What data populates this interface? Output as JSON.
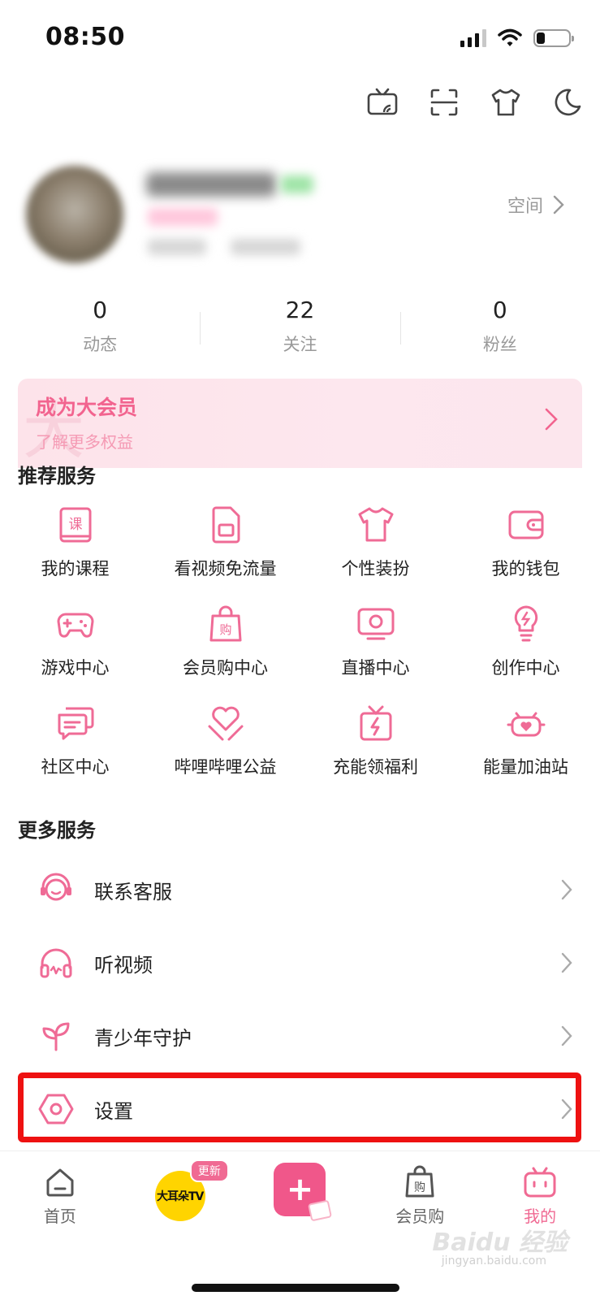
{
  "status_bar": {
    "time": "08:50",
    "battery_level": 0.25
  },
  "top_toolbar": {
    "icons": [
      "cast-tv-icon",
      "scan-icon",
      "dress-up-icon",
      "night-mode-icon"
    ]
  },
  "profile": {
    "space_label": "空间"
  },
  "stats": [
    {
      "value": "0",
      "label": "动态"
    },
    {
      "value": "22",
      "label": "关注"
    },
    {
      "value": "0",
      "label": "粉丝"
    }
  ],
  "vip_banner": {
    "title": "成为大会员",
    "subtitle": "了解更多权益"
  },
  "recommended": {
    "title": "推荐服务",
    "items": [
      {
        "label": "我的课程",
        "icon": "course-book-icon"
      },
      {
        "label": "看视频免流量",
        "icon": "sim-card-icon"
      },
      {
        "label": "个性装扮",
        "icon": "tshirt-icon"
      },
      {
        "label": "我的钱包",
        "icon": "wallet-icon"
      },
      {
        "label": "游戏中心",
        "icon": "gamepad-icon"
      },
      {
        "label": "会员购中心",
        "icon": "shopping-bag-icon"
      },
      {
        "label": "直播中心",
        "icon": "live-tv-icon"
      },
      {
        "label": "创作中心",
        "icon": "lightbulb-icon"
      },
      {
        "label": "社区中心",
        "icon": "chat-bubble-icon"
      },
      {
        "label": "哔哩哔哩公益",
        "icon": "heart-hands-icon"
      },
      {
        "label": "充能领福利",
        "icon": "gift-bolt-icon"
      },
      {
        "label": "能量加油站",
        "icon": "heart-robot-icon"
      }
    ]
  },
  "more_services": {
    "title": "更多服务",
    "items": [
      {
        "label": "联系客服",
        "icon": "headset-service-icon"
      },
      {
        "label": "听视频",
        "icon": "headphones-icon"
      },
      {
        "label": "青少年守护",
        "icon": "sprout-icon"
      },
      {
        "label": "设置",
        "icon": "settings-hexagon-icon"
      }
    ]
  },
  "bottom_nav": {
    "items": [
      {
        "label": "首页",
        "icon": "home-icon"
      },
      {
        "label": "",
        "icon": "big-ear-tv-icon",
        "logo_text": "大耳朵TV",
        "badge": "更新"
      },
      {
        "label": "",
        "icon": "post-plus-icon",
        "plus": "+"
      },
      {
        "label": "会员购",
        "icon": "shopping-bag-icon"
      },
      {
        "label": "我的",
        "icon": "mine-tv-icon"
      }
    ]
  },
  "watermark": {
    "text": "Baidu 经验",
    "sub": "jingyan.baidu.com"
  },
  "colors": {
    "accent": "#f06a93",
    "highlight": "#ee1111",
    "vip_bg": "#fde3ea"
  }
}
